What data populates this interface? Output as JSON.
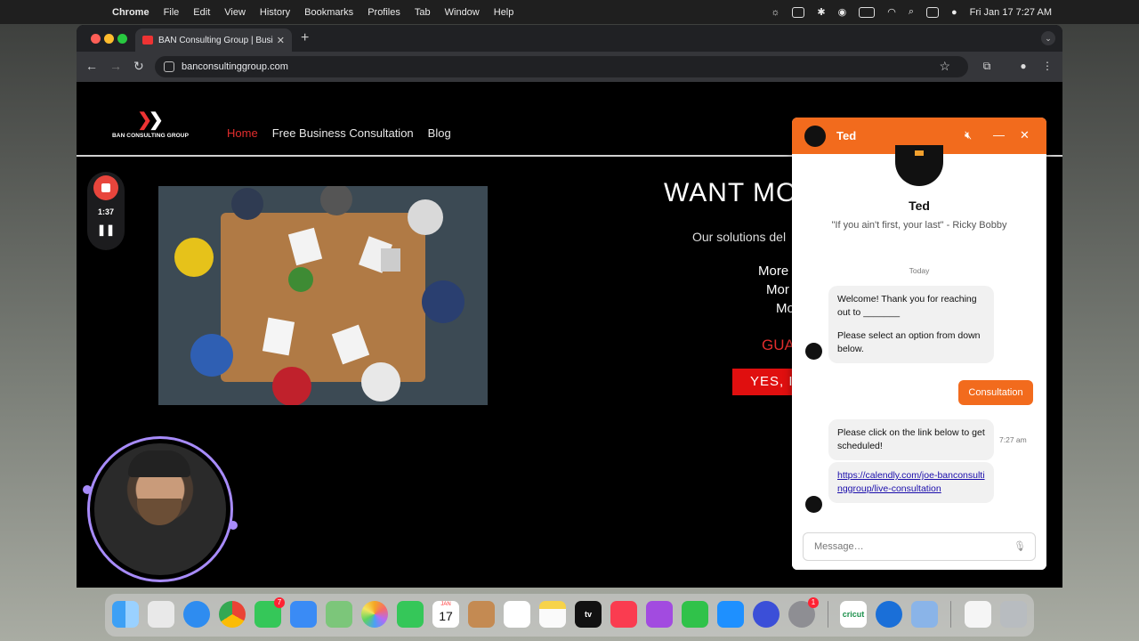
{
  "menubar": {
    "app": "Chrome",
    "menus": [
      "File",
      "Edit",
      "View",
      "History",
      "Bookmarks",
      "Profiles",
      "Tab",
      "Window",
      "Help"
    ],
    "clock": "Fri Jan 17  7:27 AM"
  },
  "browser": {
    "tab_title": "BAN Consulting Group | Busi",
    "url": "banconsultinggroup.com"
  },
  "site": {
    "logo_text": "BAN CONSULTING GROUP",
    "nav": [
      "Home",
      "Free Business Consultation",
      "Blog"
    ],
    "headline": "WANT MO",
    "subline": "Our solutions del",
    "more_lines": [
      "More",
      "Mor",
      "Mo"
    ],
    "guarantee": "GUA",
    "cta": "YES, I"
  },
  "recorder": {
    "time": "1:37"
  },
  "chat": {
    "agent": "Ted",
    "quote": "\"If you ain't first, your last\" - Ricky Bobby",
    "today": "Today",
    "msg1_p1": "Welcome! Thank you for reaching out to _______",
    "msg1_p2": "Please select an option from down below.",
    "user_reply": "Consultation",
    "msg2": "Please click on the link below to get scheduled!",
    "timestamp": "7:27 am",
    "link": "https://calendly.com/joe-banconsultinggroup/live-consultation",
    "input_placeholder": "Message…",
    "accent": "#f26b1d"
  },
  "dock": {
    "messages_badge": "7",
    "settings_badge": "1",
    "calendar_month": "JAN",
    "calendar_day": "17",
    "tv_label": "tv",
    "cricut_label": "cricut"
  }
}
